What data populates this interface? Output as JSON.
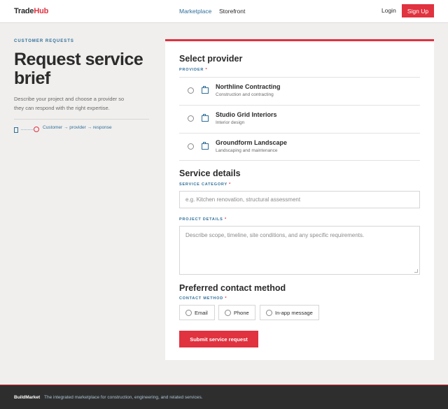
{
  "header": {
    "logo_part1": "Trade",
    "logo_part2": "Hub",
    "nav": [
      {
        "label": "Marketplace"
      },
      {
        "label": "Storefront"
      }
    ],
    "login_label": "Login",
    "signup_label": "Sign Up"
  },
  "intro": {
    "eyebrow": "CUSTOMER REQUESTS",
    "title": "Request service brief",
    "description": "Describe your project and choose a provider so they can respond with the right expertise.",
    "flow_text": "Customer → provider → response"
  },
  "form": {
    "provider_section": {
      "title": "Select provider",
      "label": "PROVIDER",
      "required_mark": "*",
      "providers": [
        {
          "name": "Northline Contracting",
          "subtitle": "Construction and contracting",
          "icon": "building-icon"
        },
        {
          "name": "Studio Grid Interiors",
          "subtitle": "Interior design",
          "icon": "building-icon"
        },
        {
          "name": "Groundform Landscape",
          "subtitle": "Landscaping and maintenance",
          "icon": "building-icon"
        }
      ]
    },
    "details_section": {
      "title": "Service details",
      "category_label": "SERVICE CATEGORY",
      "category_placeholder": "e.g. Kitchen renovation, structural assessment",
      "project_label": "PROJECT DETAILS",
      "project_placeholder": "Describe scope, timeline, site conditions, and any specific requirements.",
      "required_mark": "*"
    },
    "contact_section": {
      "title": "Preferred contact method",
      "label": "CONTACT METHOD",
      "required_mark": "*",
      "options": [
        {
          "label": "Email"
        },
        {
          "label": "Phone"
        },
        {
          "label": "In-app message"
        }
      ]
    },
    "submit_label": "Submit service request"
  },
  "footer": {
    "brand": "BuildMarket",
    "text": "The integrated marketplace for construction, engineering, and related services."
  },
  "colors": {
    "accent": "#e0323f",
    "link": "#2f6f9a",
    "background": "#f0efed",
    "footer": "#2e2e2e"
  }
}
